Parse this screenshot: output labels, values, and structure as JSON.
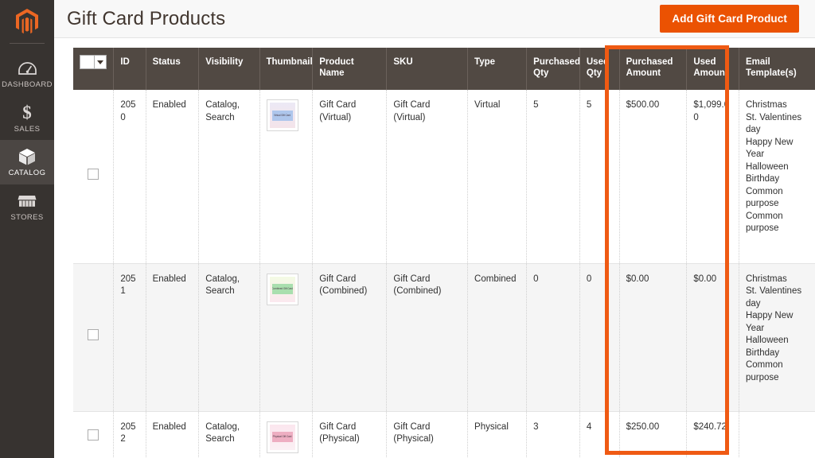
{
  "sidebar": {
    "logo": {
      "icon": "magento-logo-icon"
    },
    "items": [
      {
        "label": "DASHBOARD",
        "icon": "dashboard-gauge-icon",
        "active": false
      },
      {
        "label": "SALES",
        "icon": "dollar-sign-icon",
        "active": false
      },
      {
        "label": "CATALOG",
        "icon": "catalog-box-icon",
        "active": true
      },
      {
        "label": "STORES",
        "icon": "stores-storefront-icon",
        "active": false
      }
    ]
  },
  "header": {
    "title": "Gift Card Products",
    "primary_button": "Add Gift Card Product",
    "accent_color": "#eb5202"
  },
  "grid": {
    "columns": [
      {
        "key": "select",
        "label": ""
      },
      {
        "key": "id",
        "label": "ID"
      },
      {
        "key": "status",
        "label": "Status"
      },
      {
        "key": "visibility",
        "label": "Visibility"
      },
      {
        "key": "thumbnail",
        "label": "Thumbnail"
      },
      {
        "key": "product_name",
        "label": "Product Name"
      },
      {
        "key": "sku",
        "label": "SKU"
      },
      {
        "key": "type",
        "label": "Type"
      },
      {
        "key": "purchased_qty",
        "label": "Purchased Qty"
      },
      {
        "key": "used_qty",
        "label": "Used Qty"
      },
      {
        "key": "purchased_amount",
        "label": "Purchased Amount"
      },
      {
        "key": "used_amount",
        "label": "Used Amount"
      },
      {
        "key": "email_templates",
        "label": "Email Template(s)"
      }
    ],
    "rows": [
      {
        "id": "2050",
        "status": "Enabled",
        "visibility": "Catalog, Search",
        "thumbnail_label": "Virtual Gift Card",
        "thumbnail_variant": "virtual",
        "product_name": "Gift Card (Virtual)",
        "sku": "Gift Card (Virtual)",
        "type": "Virtual",
        "purchased_qty": "5",
        "used_qty": "5",
        "purchased_amount": "$500.00",
        "used_amount": "$1,099.00",
        "email_templates": [
          "Christmas",
          "St. Valentines day",
          "Happy New Year",
          "Halloween",
          "Birthday",
          "Common purpose",
          "Common purpose"
        ]
      },
      {
        "id": "2051",
        "status": "Enabled",
        "visibility": "Catalog, Search",
        "thumbnail_label": "Combined Gift Card",
        "thumbnail_variant": "combined",
        "product_name": "Gift Card (Combined)",
        "sku": "Gift Card (Combined)",
        "type": "Combined",
        "purchased_qty": "0",
        "used_qty": "0",
        "purchased_amount": "$0.00",
        "used_amount": "$0.00",
        "email_templates": [
          "Christmas",
          "St. Valentines day",
          "Happy New Year",
          "Halloween",
          "Birthday",
          "Common purpose"
        ]
      },
      {
        "id": "2052",
        "status": "Enabled",
        "visibility": "Catalog, Search",
        "thumbnail_label": "Physical Gift Card",
        "thumbnail_variant": "physical",
        "product_name": "Gift Card (Physical)",
        "sku": "Gift Card (Physical)",
        "type": "Physical",
        "purchased_qty": "3",
        "used_qty": "4",
        "purchased_amount": "$250.00",
        "used_amount": "$240.72",
        "email_templates": []
      }
    ]
  },
  "annotation": {
    "highlight_color": "#ef5a13",
    "highlighted_columns": [
      "Purchased Amount",
      "Used Amount"
    ]
  }
}
